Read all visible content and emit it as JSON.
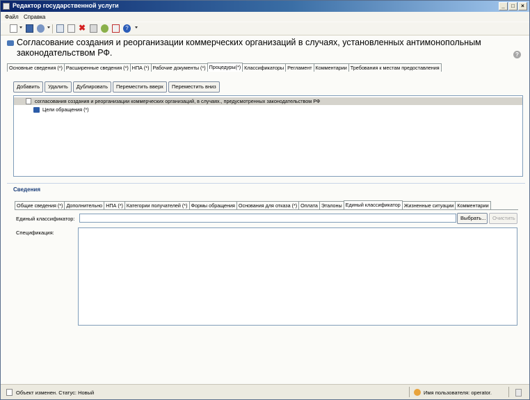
{
  "window": {
    "title": "Редактор государственной услуги",
    "controls": [
      "_",
      "□",
      "×"
    ]
  },
  "menu": [
    "Файл",
    "Справка"
  ],
  "header": {
    "title": "Согласование создания и реорганизации коммерческих организаций в случаях, установленных антимонопольным законодательством РФ.",
    "help_glyph": "?"
  },
  "top_tabs": [
    "Основные сведения (*)",
    "Расширенные сведения (*)",
    "НПА (*)",
    "Рабочие документы (*)",
    "Процедуры(*)",
    "Классификаторы",
    "Регламент",
    "Комментарии",
    "Требования к местам предоставления"
  ],
  "top_tabs_active": 4,
  "actions": {
    "add": "Добавить",
    "delete": "Удалить",
    "duplicate": "Дублировать",
    "move_up": "Переместить вверх",
    "move_down": "Переместить вниз"
  },
  "tree": {
    "root_label": "согласования создания и реорганизации коммерческих организаций, в случаях., предусмотренных законодательством РФ",
    "child_label": "Цели обращения (*)"
  },
  "details": {
    "title": "Сведения",
    "tabs": [
      "Общие сведения (*)",
      "Дополнительно",
      "НПА (*)",
      "Категории получателей (*)",
      "Формы обращения",
      "Основания для отказа (*)",
      "Оплата",
      "Эталоны",
      "Единый классификатор",
      "Жизненные ситуации",
      "Комментарии"
    ],
    "tabs_active": 8,
    "classifier_label": "Единый классификатор:",
    "classifier_value": "",
    "choose_button": "Выбрать...",
    "clear_button": "Очистить",
    "spec_label": "Спецификация:",
    "spec_value": ""
  },
  "status": {
    "left": "Объект изменен. Статус: Новый",
    "user": "Имя пользователя: operator."
  },
  "colors": {
    "titlebar_start": "#0a246a",
    "titlebar_end": "#a6caf0",
    "section_title": "#1c3f7a",
    "selection": "#d5d3cc"
  }
}
